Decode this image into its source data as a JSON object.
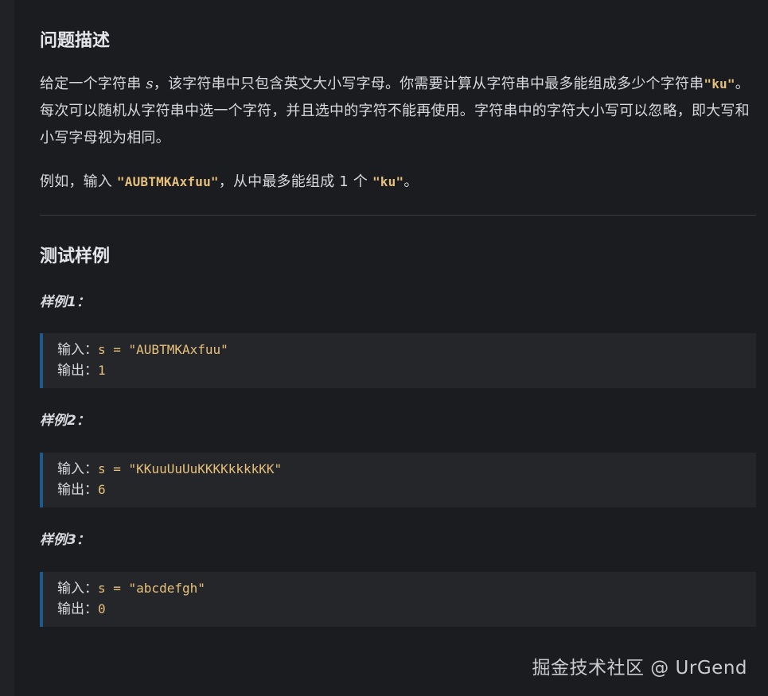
{
  "sections": {
    "description_title": "问题描述",
    "test_title": "测试样例"
  },
  "description": {
    "p1_before_var": "给定一个字符串 ",
    "p1_var": "s",
    "p1_after_var": "，该字符串中只包含英文大小写字母。你需要计算从字符串中最多能组成多少个字符串",
    "p1_code": "\"ku\"",
    "p1_tail": "。每次可以随机从字符串中选一个字符，并且选中的字符不能再使用。字符串中的字符大小写可以忽略，即大写和小写字母视为相同。",
    "p2_prefix": "例如，输入 ",
    "p2_code_input": "\"AUBTMKAxfuu\"",
    "p2_middle": "，从中最多能组成 1 个 ",
    "p2_code_target": "\"ku\"",
    "p2_suffix": "。"
  },
  "examples": [
    {
      "label": "样例1：",
      "input_label": "输入：",
      "input_value": "s = \"AUBTMKAxfuu\"",
      "output_label": "输出：",
      "output_value": "1"
    },
    {
      "label": "样例2：",
      "input_label": "输入：",
      "input_value": "s = \"KKuuUuUuKKKKkkkkKK\"",
      "output_label": "输出：",
      "output_value": "6"
    },
    {
      "label": "样例3：",
      "input_label": "输入：",
      "input_value": "s = \"abcdefgh\"",
      "output_label": "输出：",
      "output_value": "0"
    }
  ],
  "watermark": "掘金技术社区 @ UrGend",
  "colors": {
    "background": "#1b1c1f",
    "code_text": "#e6c07b",
    "block_border": "#1e5a8e",
    "block_bg": "#25262a"
  }
}
